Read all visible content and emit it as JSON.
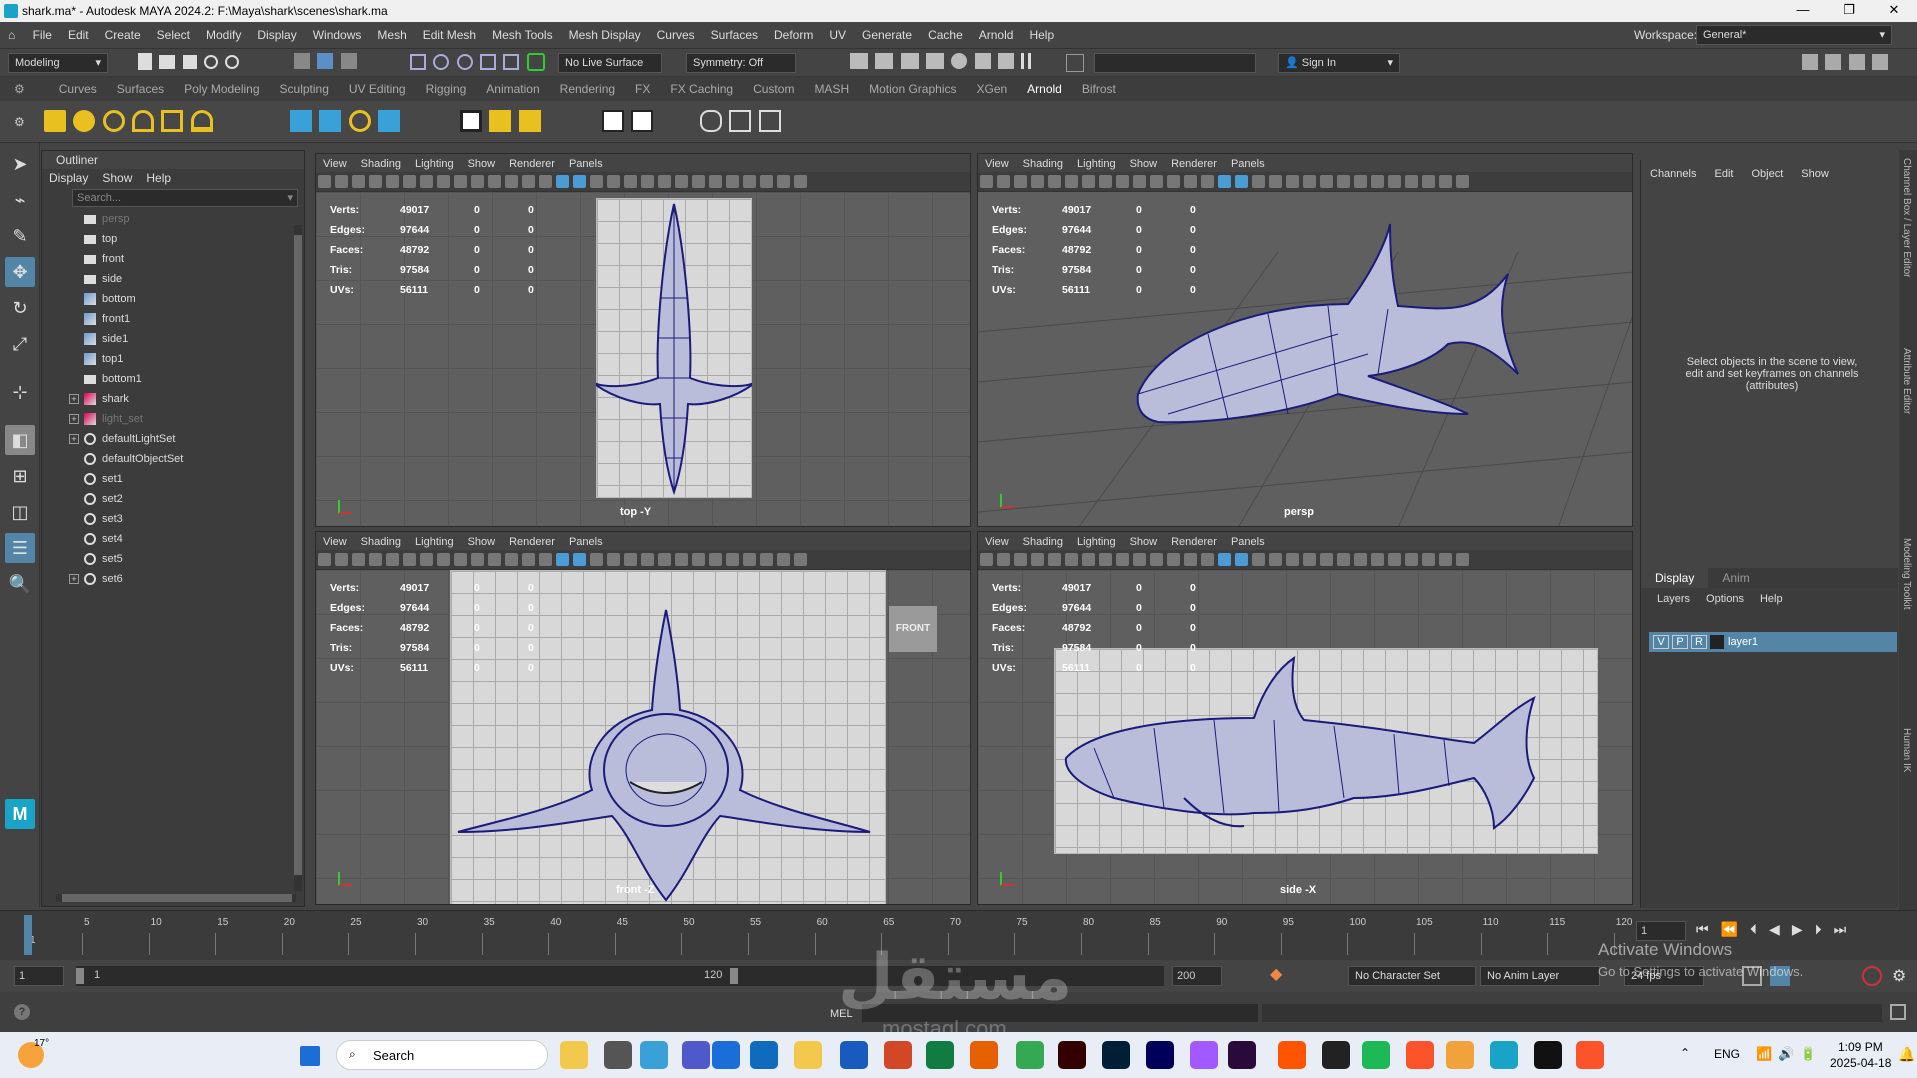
{
  "window": {
    "title": "shark.ma* - Autodesk MAYA 2024.2: F:\\Maya\\shark\\scenes\\shark.ma",
    "minimize": "—",
    "maximize": "❐",
    "close": "✕"
  },
  "menu": [
    "File",
    "Edit",
    "Create",
    "Select",
    "Modify",
    "Display",
    "Windows",
    "Mesh",
    "Edit Mesh",
    "Mesh Tools",
    "Mesh Display",
    "Curves",
    "Surfaces",
    "Deform",
    "UV",
    "Generate",
    "Cache",
    "Arnold",
    "Help"
  ],
  "workspace": {
    "label": "Workspace:",
    "value": "General*"
  },
  "statusline": {
    "mode": "Modeling",
    "live_surface": "No Live Surface",
    "symmetry": "Symmetry: Off",
    "sign_in": "Sign In"
  },
  "shelf_tabs": [
    "Curves",
    "Surfaces",
    "Poly Modeling",
    "Sculpting",
    "UV Editing",
    "Rigging",
    "Animation",
    "Rendering",
    "FX",
    "FX Caching",
    "Custom",
    "MASH",
    "Motion Graphics",
    "XGen",
    "Arnold",
    "Bifrost"
  ],
  "active_shelf_tab": "Arnold",
  "outliner": {
    "title": "Outliner",
    "menu": [
      "Display",
      "Show",
      "Help"
    ],
    "search_placeholder": "Search...",
    "items": [
      {
        "label": "persp",
        "icon": "camera-icon",
        "dim": true
      },
      {
        "label": "top",
        "icon": "camera-icon"
      },
      {
        "label": "front",
        "icon": "camera-icon"
      },
      {
        "label": "side",
        "icon": "camera-icon"
      },
      {
        "label": "bottom",
        "icon": "image-plane-icon"
      },
      {
        "label": "front1",
        "icon": "image-plane-icon"
      },
      {
        "label": "side1",
        "icon": "image-plane-icon"
      },
      {
        "label": "top1",
        "icon": "image-plane-icon"
      },
      {
        "label": "bottom1",
        "icon": "camera-icon"
      },
      {
        "label": "shark",
        "icon": "mesh-icon",
        "expand": "+"
      },
      {
        "label": "light_set",
        "icon": "mesh-icon",
        "dim": true,
        "expand": "+"
      },
      {
        "label": "defaultLightSet",
        "icon": "set-icon",
        "expand": "+"
      },
      {
        "label": "defaultObjectSet",
        "icon": "set-icon"
      },
      {
        "label": "set1",
        "icon": "set-icon"
      },
      {
        "label": "set2",
        "icon": "set-icon"
      },
      {
        "label": "set3",
        "icon": "set-icon"
      },
      {
        "label": "set4",
        "icon": "set-icon"
      },
      {
        "label": "set5",
        "icon": "set-icon"
      },
      {
        "label": "set6",
        "icon": "set-icon",
        "expand": "+"
      }
    ]
  },
  "viewport_menu": [
    "View",
    "Shading",
    "Lighting",
    "Show",
    "Renderer",
    "Panels"
  ],
  "hud": {
    "labels": [
      "Verts:",
      "Edges:",
      "Faces:",
      "Tris:",
      "UVs:"
    ],
    "values": [
      "49017",
      "97644",
      "48792",
      "97584",
      "56111"
    ],
    "zero": "0"
  },
  "viewports": [
    {
      "name": "top",
      "label": "top -Y"
    },
    {
      "name": "persp",
      "label": "persp"
    },
    {
      "name": "front",
      "label": "front -Z"
    },
    {
      "name": "side",
      "label": "side -X"
    }
  ],
  "front_cube": "FRONT",
  "channel_box": {
    "menu": [
      "Channels",
      "Edit",
      "Object",
      "Show"
    ],
    "message": "Select objects in the scene to view, edit and set keyframes on channels (attributes)",
    "side_tabs": [
      "Channel Box / Layer Editor",
      "Attribute Editor",
      "Modeling Toolkit",
      "Human IK"
    ]
  },
  "layer_editor": {
    "tabs": [
      "Display",
      "Anim"
    ],
    "menu": [
      "Layers",
      "Options",
      "Help"
    ],
    "layer": {
      "v": "V",
      "p": "P",
      "r": "R",
      "name": "layer1"
    }
  },
  "timeline": {
    "ticks": [
      "1",
      "5",
      "10",
      "15",
      "20",
      "25",
      "30",
      "35",
      "40",
      "45",
      "50",
      "55",
      "60",
      "65",
      "70",
      "75",
      "80",
      "85",
      "90",
      "95",
      "100",
      "105",
      "110",
      "115",
      "120"
    ],
    "current_frame": "1"
  },
  "range": {
    "start": "1",
    "inner_start": "1",
    "inner_end": "120",
    "end": "200",
    "character_set": "No Character Set",
    "anim_layer": "No Anim Layer",
    "fps": "24 fps"
  },
  "command": {
    "lang": "MEL",
    "help_icon": "?"
  },
  "watermark": {
    "activate": "Activate Windows",
    "goto": "Go to Settings to activate Windows.",
    "brand": "مستقل",
    "site": "mostaql.com"
  },
  "taskbar": {
    "weather": "17°",
    "search": "Search",
    "lang": "ENG",
    "time": "1:09 PM",
    "date": "2025-04-18"
  }
}
